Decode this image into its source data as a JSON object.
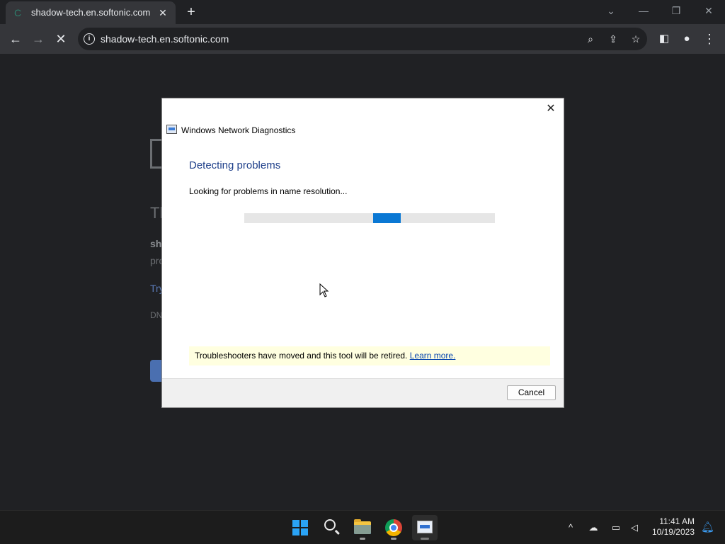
{
  "browser": {
    "tab_title": "shadow-tech.en.softonic.com",
    "url": "shadow-tech.en.softonic.com"
  },
  "page_background": {
    "heading": "Th",
    "line1": "sh",
    "line2": "pro",
    "link": "Try",
    "small": "DN"
  },
  "dialog": {
    "title": "Windows Network Diagnostics",
    "heading": "Detecting problems",
    "status": "Looking for problems in name resolution...",
    "progress_mode": "indeterminate",
    "notice_text": "Troubleshooters have moved and this tool will be retired. ",
    "notice_link": "Learn more.",
    "cancel_label": "Cancel"
  },
  "taskbar": {
    "time": "11:41 AM",
    "date": "10/19/2023"
  },
  "colors": {
    "accent": "#0a78d4",
    "dialog_heading": "#1e3f8a",
    "notice_bg": "#ffffe0"
  }
}
